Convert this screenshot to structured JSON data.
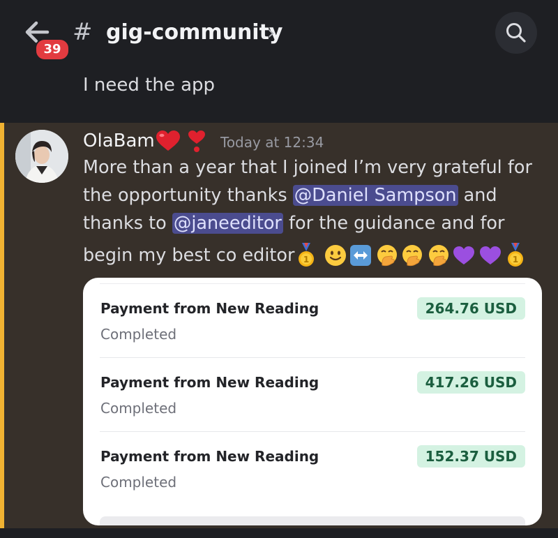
{
  "header": {
    "unread_badge": "39",
    "channel_hash": "#",
    "channel_name": "gig-community",
    "chevron": "›",
    "icons": {
      "back": "arrow-left-icon",
      "search": "search-icon"
    }
  },
  "previous_message": {
    "text": "I need the app"
  },
  "message": {
    "author": "OlaBam",
    "author_decorations": [
      "red-heart-icon",
      "heart-exclamation-icon"
    ],
    "timestamp": "Today at 12:34",
    "lines": [
      {
        "text": "More than a year that I joined I’m very grateful for"
      },
      {
        "before": "the opportunity  thanks ",
        "mention": "@Daniel Sampson",
        "after": " and"
      },
      {
        "before": "thanks to ",
        "mention": "@janeeditor",
        "after": " for the guidance and for"
      },
      {
        "text": "begin my best co editor"
      }
    ],
    "emojis": [
      "medal-icon",
      "slightly-smiling-face-icon",
      "left-right-arrow-icon",
      "hand-over-mouth-icon",
      "hand-over-mouth-icon",
      "hand-over-mouth-icon",
      "purple-heart-icon",
      "purple-heart-icon",
      "medal-icon"
    ],
    "mention_color": "#4b4c8f",
    "highlight_bar_color": "#f0b232"
  },
  "payments": [
    {
      "title": "Payment from New Reading",
      "status": "Completed",
      "amount": "264.76 USD"
    },
    {
      "title": "Payment from New Reading",
      "status": "Completed",
      "amount": "417.26 USD"
    },
    {
      "title": "Payment from New Reading",
      "status": "Completed",
      "amount": "152.37 USD"
    }
  ],
  "colors": {
    "background": "#1e1f23",
    "highlight_background": "#37302a",
    "badge": "#e23b40",
    "amount_pill": "#d4f2e2",
    "amount_text": "#1b5e3f"
  }
}
